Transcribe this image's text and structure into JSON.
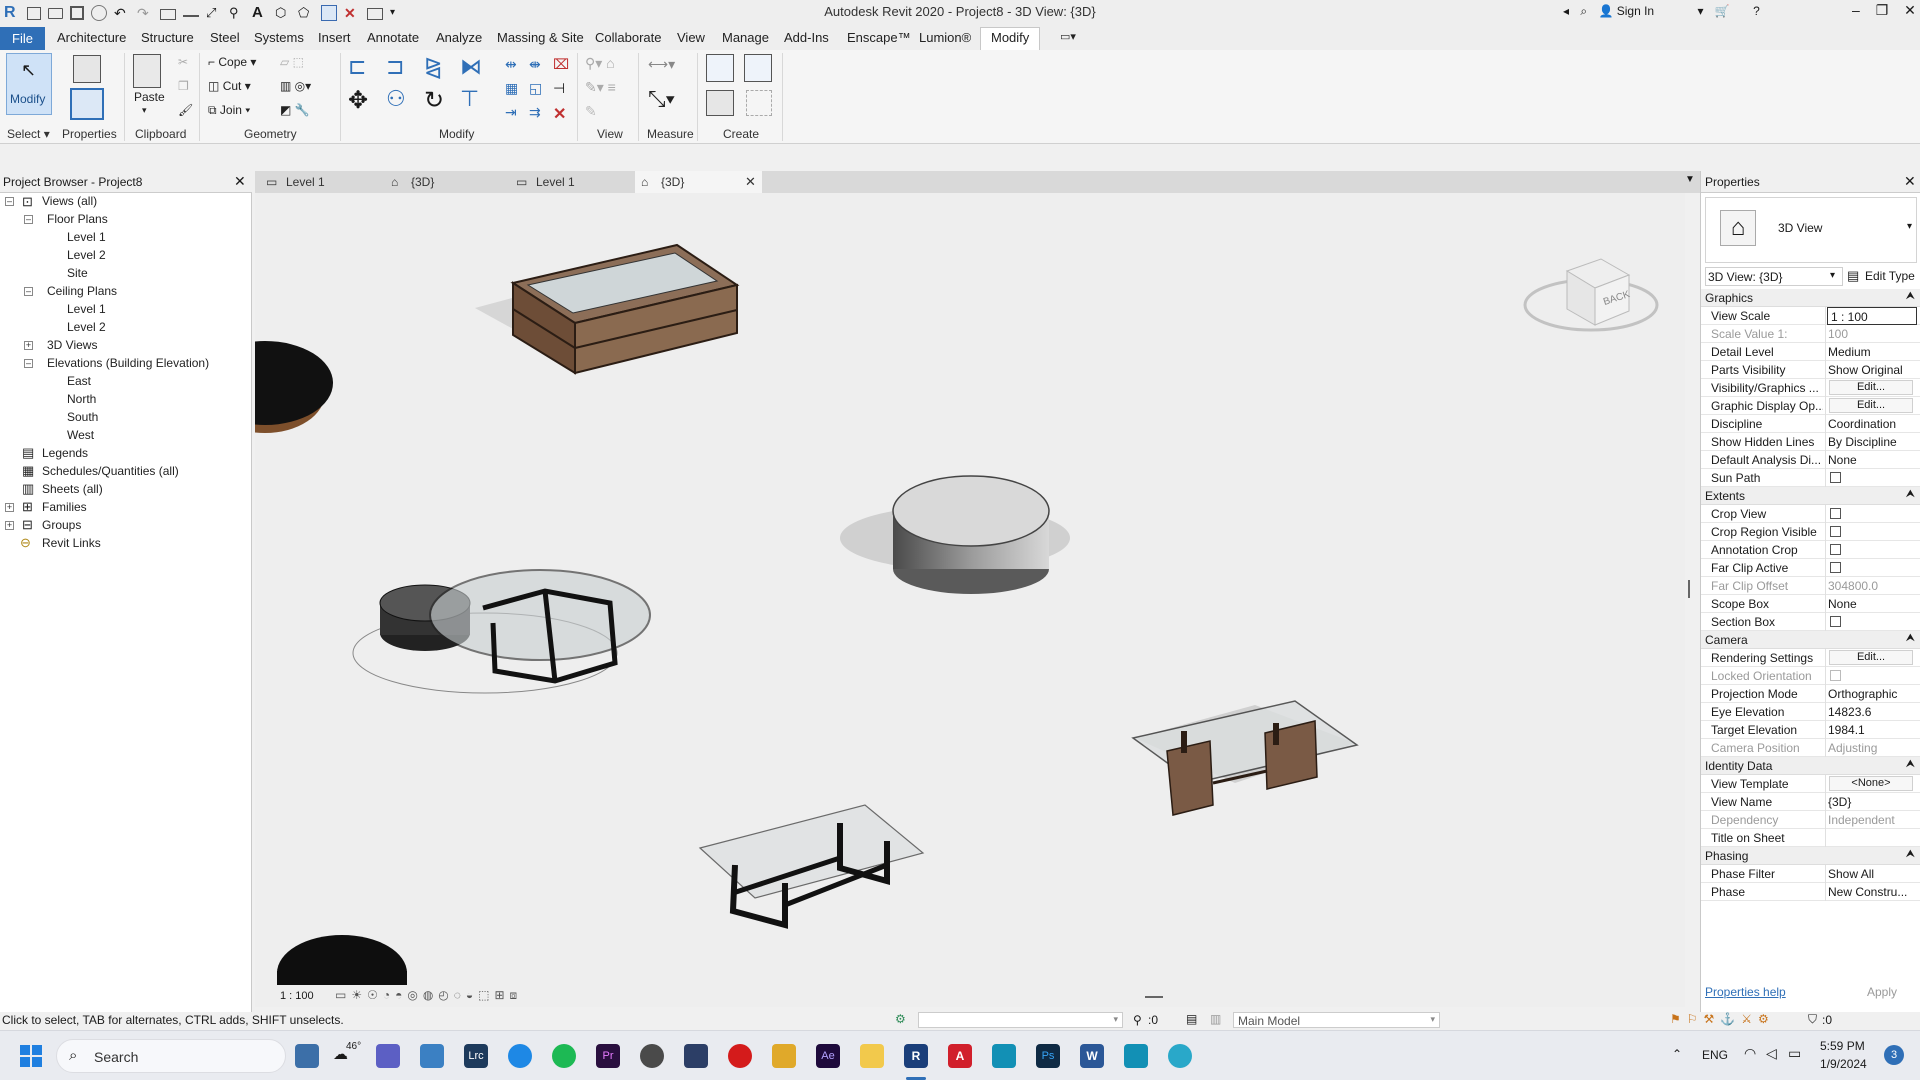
{
  "window": {
    "title": "Autodesk Revit 2020 - Project8 - 3D View: {3D}",
    "sign_in": "Sign In"
  },
  "menu": {
    "file": "File",
    "tabs": [
      "Architecture",
      "Structure",
      "Steel",
      "Systems",
      "Insert",
      "Annotate",
      "Analyze",
      "Massing & Site",
      "Collaborate",
      "View",
      "Manage",
      "Add-Ins",
      "Enscape™",
      "Lumion®",
      "Modify"
    ]
  },
  "ribbon": {
    "modify_label": "Modify",
    "properties_label": "Properties",
    "paste_label": "Paste",
    "cope": "Cope",
    "cut": "Cut",
    "join": "Join",
    "panels": {
      "select": "Select",
      "properties": "Properties",
      "clipboard": "Clipboard",
      "geometry": "Geometry",
      "modify": "Modify",
      "view": "View",
      "measure": "Measure",
      "create": "Create"
    }
  },
  "project_browser": {
    "title": "Project Browser - Project8",
    "tree": {
      "views_all": "Views (all)",
      "floor_plans": "Floor Plans",
      "fp_level1": "Level 1",
      "fp_level2": "Level 2",
      "fp_site": "Site",
      "ceiling_plans": "Ceiling Plans",
      "cp_level1": "Level 1",
      "cp_level2": "Level 2",
      "views_3d": "3D Views",
      "elevations": "Elevations (Building Elevation)",
      "east": "East",
      "north": "North",
      "south": "South",
      "west": "West",
      "legends": "Legends",
      "schedules": "Schedules/Quantities (all)",
      "sheets": "Sheets (all)",
      "families": "Families",
      "groups": "Groups",
      "revit_links": "Revit Links"
    }
  },
  "view_tabs": [
    "Level 1",
    "{3D}",
    "Level 1",
    "{3D}"
  ],
  "viewcube": {
    "face": "BACK"
  },
  "view_control": {
    "scale": "1 : 100"
  },
  "properties": {
    "title": "Properties",
    "type_name": "3D View",
    "selector": "3D View: {3D}",
    "edit_type": "Edit Type",
    "sections": {
      "graphics": "Graphics",
      "extents": "Extents",
      "camera": "Camera",
      "identity": "Identity Data",
      "phasing": "Phasing"
    },
    "graphics": {
      "view_scale_k": "View Scale",
      "view_scale_v": "1 : 100",
      "scale_value_k": "Scale Value    1:",
      "scale_value_v": "100",
      "detail_level_k": "Detail Level",
      "detail_level_v": "Medium",
      "parts_visibility_k": "Parts Visibility",
      "parts_visibility_v": "Show Original",
      "vg_k": "Visibility/Graphics ...",
      "vg_v": "Edit...",
      "gdo_k": "Graphic Display Op...",
      "gdo_v": "Edit...",
      "discipline_k": "Discipline",
      "discipline_v": "Coordination",
      "hidden_lines_k": "Show Hidden Lines",
      "hidden_lines_v": "By Discipline",
      "analysis_k": "Default Analysis Di...",
      "analysis_v": "None",
      "sun_path_k": "Sun Path"
    },
    "extents": {
      "crop_view_k": "Crop View",
      "crop_region_k": "Crop Region Visible",
      "annotation_crop_k": "Annotation Crop",
      "far_clip_active_k": "Far Clip Active",
      "far_clip_offset_k": "Far Clip Offset",
      "far_clip_offset_v": "304800.0",
      "scope_box_k": "Scope Box",
      "scope_box_v": "None",
      "section_box_k": "Section Box"
    },
    "camera": {
      "rendering_k": "Rendering Settings",
      "rendering_v": "Edit...",
      "locked_k": "Locked Orientation",
      "projection_k": "Projection Mode",
      "projection_v": "Orthographic",
      "eye_k": "Eye Elevation",
      "eye_v": "14823.6",
      "target_k": "Target Elevation",
      "target_v": "1984.1",
      "camera_pos_k": "Camera Position",
      "camera_pos_v": "Adjusting"
    },
    "identity": {
      "template_k": "View Template",
      "template_v": "<None>",
      "view_name_k": "View Name",
      "view_name_v": "{3D}",
      "dependency_k": "Dependency",
      "dependency_v": "Independent",
      "title_sheet_k": "Title on Sheet",
      "title_sheet_v": ""
    },
    "phasing": {
      "filter_k": "Phase Filter",
      "filter_v": "Show All",
      "phase_k": "Phase",
      "phase_v": "New Constru..."
    },
    "help": "Properties help",
    "apply": "Apply"
  },
  "status": {
    "hint": "Click to select, TAB for alternates, CTRL adds, SHIFT unselects.",
    "workset_count": ":0",
    "model": "Main Model",
    "filter_count": ":0"
  },
  "taskbar": {
    "search": "Search",
    "weather": "46°",
    "lang": "ENG",
    "time": "5:59 PM",
    "date": "1/9/2024",
    "notifications": "3"
  },
  "colors": {
    "accent": "#2f6fb7",
    "wood": "#7a5a45",
    "glass": "#cfd6d8"
  }
}
